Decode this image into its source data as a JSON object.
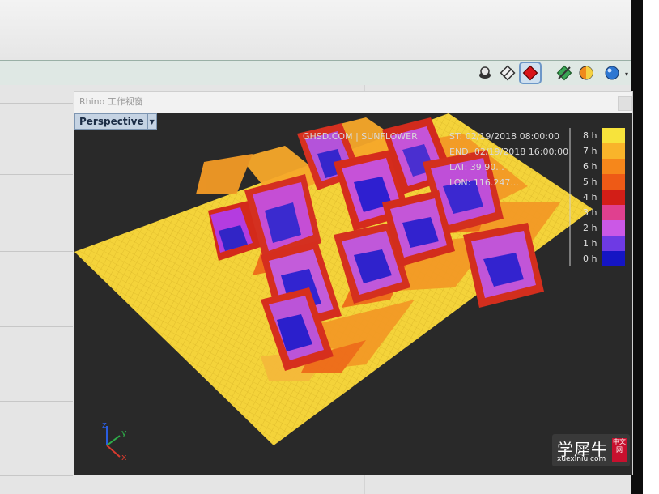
{
  "toolbar": {
    "icons": [
      {
        "name": "render-mesh-icon",
        "active": false
      },
      {
        "name": "wireframe-icon",
        "active": false
      },
      {
        "name": "render-preview-icon",
        "active": true
      },
      {
        "name": "disable-preview-icon",
        "active": false
      },
      {
        "name": "shaded-sphere-icon",
        "active": false
      },
      {
        "name": "color-sphere-icon",
        "active": false
      }
    ]
  },
  "window": {
    "title": "Rhino 工作视窗",
    "viewport_label": "Perspective"
  },
  "overlay": {
    "credit": "GHSD.COM | SUNFLOWER",
    "st_line": "ST: 02/19/2018 08:00:00",
    "end_line": "END: 02/19/2018 16:00:00",
    "lat_line": "LAT: 39.90...",
    "lon_line": "LON: 116.247..."
  },
  "legend": {
    "labels": [
      "8 h",
      "7 h",
      "6 h",
      "5 h",
      "4 h",
      "3 h",
      "2 h",
      "1 h",
      "0 h"
    ],
    "colors": [
      "#f7e33b",
      "#f9b42a",
      "#f6871b",
      "#ee5a16",
      "#d21e17",
      "#e0408f",
      "#cb58e6",
      "#6e3ae4",
      "#1515c4"
    ]
  },
  "axes": {
    "x": "x",
    "y": "y",
    "z": "z"
  },
  "watermark": {
    "brand": "学犀牛",
    "url": "xuexiniu.com",
    "tag": "中文网"
  }
}
